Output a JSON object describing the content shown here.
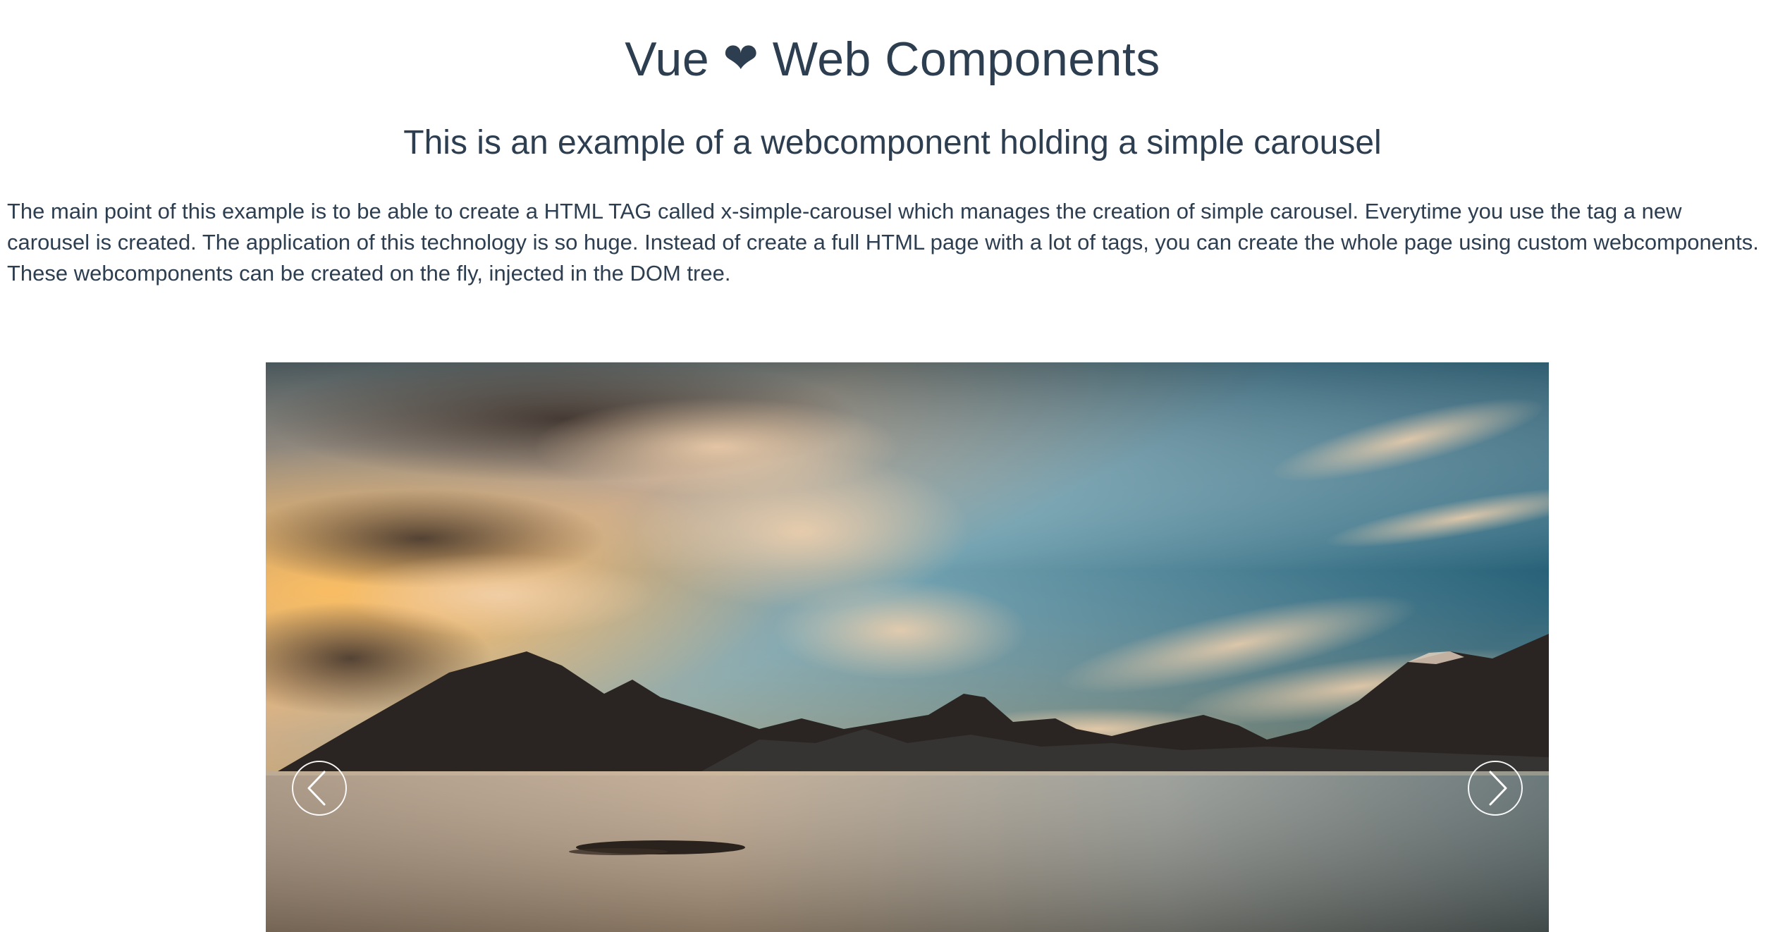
{
  "header": {
    "title_part1": "Vue",
    "heart_glyph": "❤",
    "title_part2": "Web Components",
    "subtitle": "This is an example of a webcomponent holding a simple carousel"
  },
  "intro": {
    "text": "The main point of this example is to be able to create a HTML TAG called x-simple-carousel which manages the creation of simple carousel. Everytime you use the tag a new carousel is created. The application of this technology is so huge. Instead of create a full HTML page with a lot of tags, you can create the whole page using custom webcomponents. These webcomponents can be created on the fly, injected in the DOM tree."
  },
  "carousel": {
    "slide_image": "sunset-mountain-lake-photo",
    "prev_icon": "chevron-left-icon",
    "next_icon": "chevron-right-icon"
  },
  "colors": {
    "text": "#2c3e50",
    "background": "#ffffff"
  }
}
